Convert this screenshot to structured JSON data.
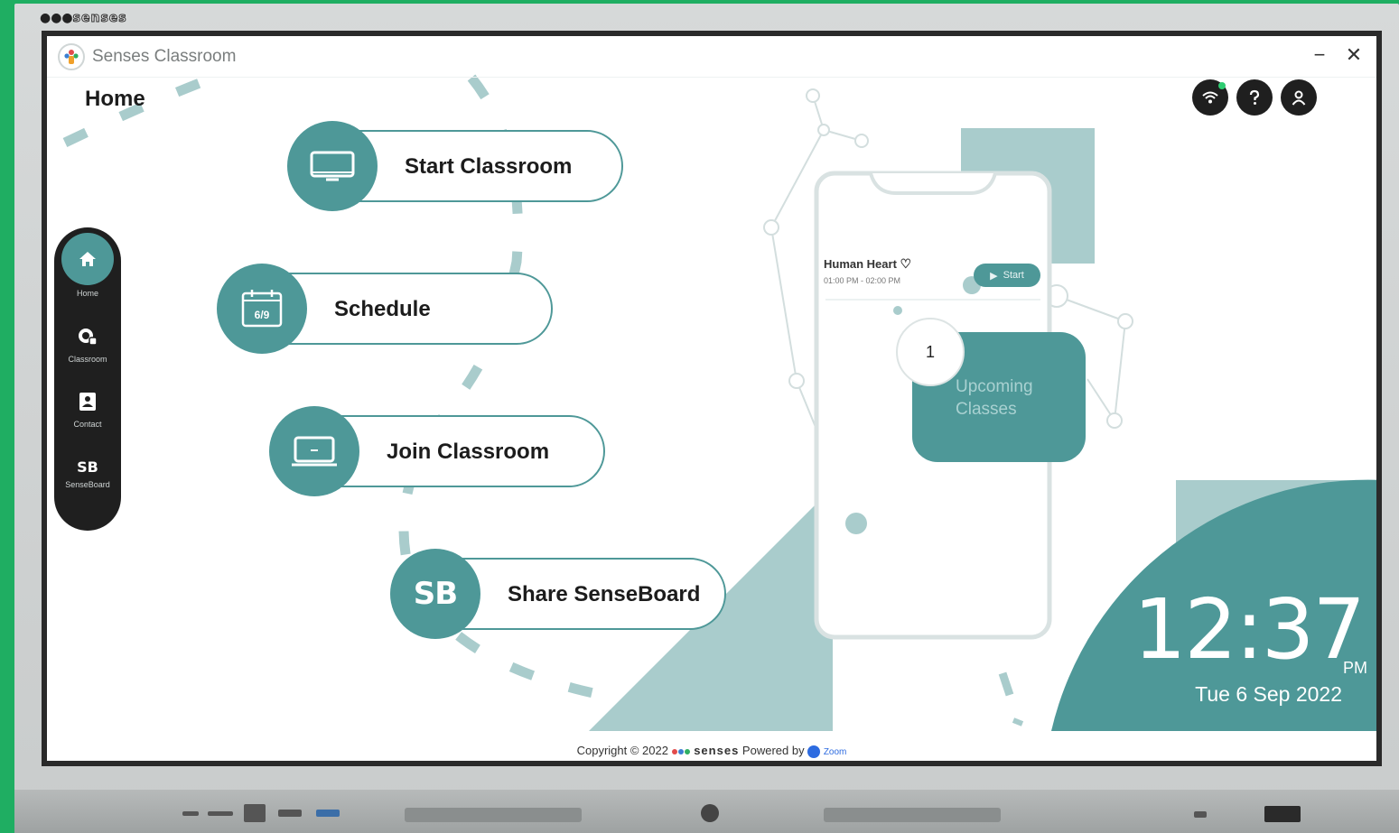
{
  "bezel": {
    "brand": "senses"
  },
  "window": {
    "title": "Senses Classroom",
    "minimize": "−",
    "close": "✕"
  },
  "page": {
    "title": "Home"
  },
  "top_icons": [
    "wifi-icon",
    "help-icon",
    "user-icon"
  ],
  "sidebar": {
    "items": [
      {
        "label": "Home",
        "icon": "home-icon"
      },
      {
        "label": "Classroom",
        "icon": "classroom-icon"
      },
      {
        "label": "Contact",
        "icon": "contact-icon"
      },
      {
        "label": "SenseBoard",
        "icon": "SB"
      }
    ]
  },
  "menu": {
    "start": {
      "label": "Start Classroom"
    },
    "schedule": {
      "label": "Schedule",
      "date": "6/9"
    },
    "join": {
      "label": "Join Classroom"
    },
    "share": {
      "label": "Share SenseBoard",
      "icon_text": "SB"
    }
  },
  "phone": {
    "class_title": "Human Heart",
    "class_time": "01:00 PM - 02:00 PM",
    "start_label": "Start",
    "upcoming_count": "1",
    "upcoming_label": "Upcoming Classes"
  },
  "clock": {
    "time": "12:37",
    "ampm": "PM",
    "date": "Tue 6 Sep 2022"
  },
  "footer": {
    "copyright": "Copyright © 2022",
    "brand": "senses",
    "powered_by": "Powered by",
    "partner": "Zoom"
  },
  "colors": {
    "accent": "#4e9898",
    "accent_light": "#a9cccc",
    "dark": "#1f1f1f",
    "bezel_green": "#1fae62"
  }
}
